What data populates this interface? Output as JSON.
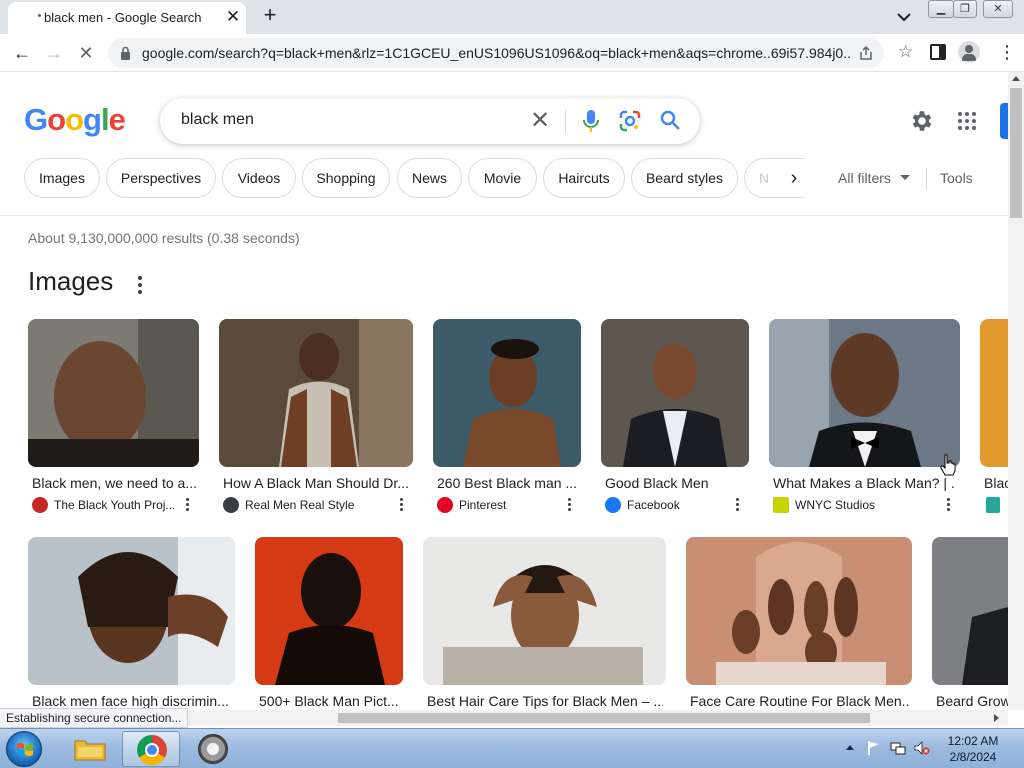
{
  "browser": {
    "tab_title": "black men - Google Search",
    "url": "google.com/search?q=black+men&rlz=1C1GCEU_enUS1096US1096&oq=black+men&aqs=chrome..69i57.984j0...",
    "status_text": "Establishing secure connection..."
  },
  "google": {
    "logo_letters": [
      "G",
      "o",
      "o",
      "g",
      "l",
      "e"
    ],
    "logo_colors": [
      "#4285F4",
      "#EA4335",
      "#FBBC05",
      "#4285F4",
      "#34A853",
      "#EA4335"
    ],
    "query": "black men",
    "chips": [
      "Images",
      "Perspectives",
      "Videos",
      "Shopping",
      "News",
      "Movie",
      "Haircuts",
      "Beard styles",
      "N"
    ],
    "all_filters": "All filters",
    "tools": "Tools",
    "result_stats": "About 9,130,000,000 results (0.38 seconds)",
    "images_heading": "Images"
  },
  "images_row1": [
    {
      "caption": "Black men, we need to a...",
      "source": "The Black Youth Proj...",
      "fav_color": "#c62828"
    },
    {
      "caption": "How A Black Man Should Dr...",
      "source": "Real Men Real Style",
      "fav_color": "#3a3f47"
    },
    {
      "caption": "260 Best Black man ...",
      "source": "Pinterest",
      "fav_color": "#e60023"
    },
    {
      "caption": "Good Black Men",
      "source": "Facebook",
      "fav_color": "#1877f2"
    },
    {
      "caption": "What Makes a Black Man? | ...",
      "source": "WNYC Studios",
      "fav_color": "#c8d400"
    },
    {
      "caption": "Blac",
      "source": "",
      "fav_color": "#26a69a"
    }
  ],
  "images_row2": [
    {
      "caption": "Black men face high discrimin..."
    },
    {
      "caption": "500+ Black Man Pict..."
    },
    {
      "caption": "Best Hair Care Tips for Black Men – ..."
    },
    {
      "caption": "Face Care Routine For Black Men..."
    },
    {
      "caption": "Beard Grow"
    }
  ],
  "taskbar": {
    "time": "12:02 AM",
    "date": "2/8/2024"
  }
}
